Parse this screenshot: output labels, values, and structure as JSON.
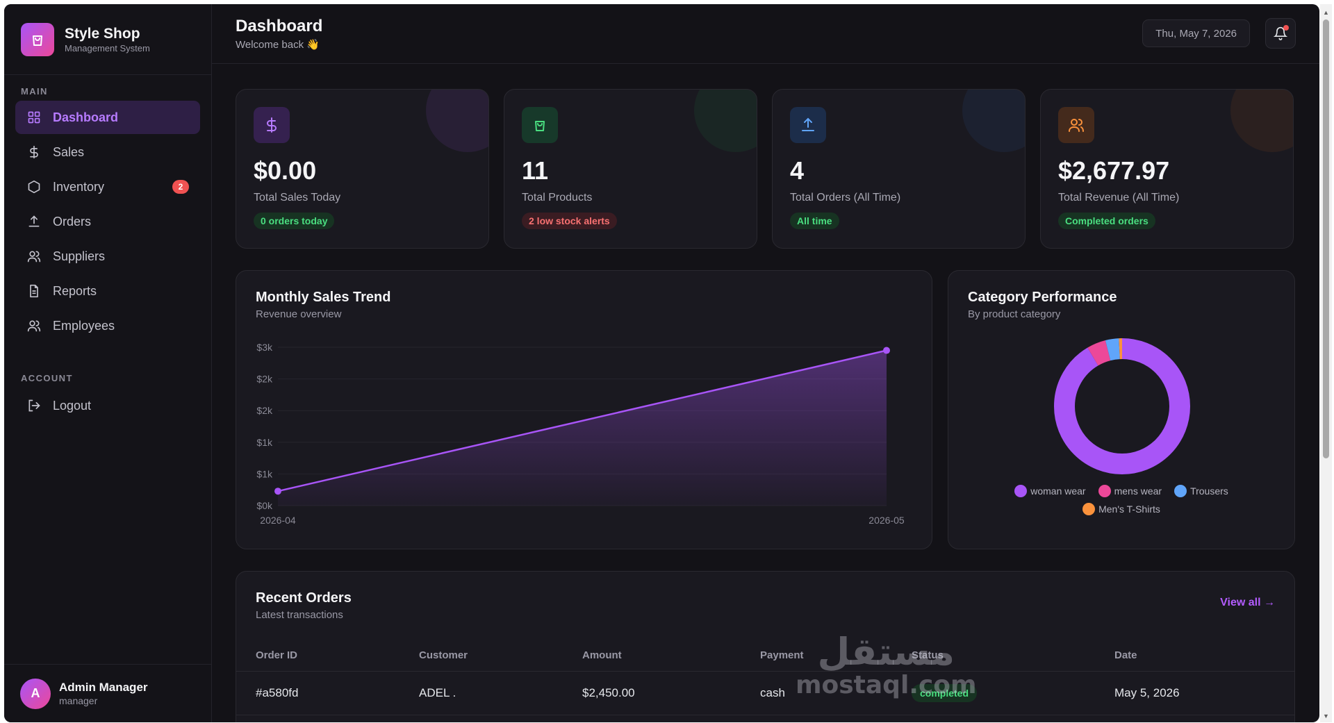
{
  "brand": {
    "name": "Style Shop",
    "subtitle": "Management System",
    "icon": "shopping-bag-icon"
  },
  "sidebar": {
    "section_main": "MAIN",
    "section_account": "ACCOUNT",
    "items": [
      {
        "label": "Dashboard",
        "icon": "dashboard-grid-icon",
        "active": true
      },
      {
        "label": "Sales",
        "icon": "dollar-icon"
      },
      {
        "label": "Inventory",
        "icon": "box-icon",
        "badge": "2"
      },
      {
        "label": "Orders",
        "icon": "upload-icon"
      },
      {
        "label": "Suppliers",
        "icon": "users-icon"
      },
      {
        "label": "Reports",
        "icon": "document-icon"
      },
      {
        "label": "Employees",
        "icon": "users-icon"
      }
    ],
    "logout": {
      "label": "Logout",
      "icon": "logout-icon"
    },
    "user": {
      "initial": "A",
      "name": "Admin Manager",
      "role": "manager"
    }
  },
  "header": {
    "title": "Dashboard",
    "subtitle": "Welcome back 👋",
    "date": "Thu, May 7, 2026"
  },
  "stats": [
    {
      "value": "$0.00",
      "label": "Total Sales Today",
      "badge": "0 orders today",
      "badge_type": "green",
      "icon": "dollar-icon",
      "accent": "#a855f7"
    },
    {
      "value": "11",
      "label": "Total Products",
      "badge": "2 low stock alerts",
      "badge_type": "red",
      "icon": "shopping-bag-icon",
      "accent": "#22c55e"
    },
    {
      "value": "4",
      "label": "Total Orders (All Time)",
      "badge": "All time",
      "badge_type": "green",
      "icon": "upload-icon",
      "accent": "#3b82f6"
    },
    {
      "value": "$2,677.97",
      "label": "Total Revenue (All Time)",
      "badge": "Completed orders",
      "badge_type": "green",
      "icon": "users-icon",
      "accent": "#f97316"
    }
  ],
  "sales_chart": {
    "title": "Monthly Sales Trend",
    "subtitle": "Revenue overview"
  },
  "category_chart": {
    "title": "Category Performance",
    "subtitle": "By product category"
  },
  "chart_data": [
    {
      "type": "area",
      "title": "Monthly Sales Trend",
      "x": [
        "2026-04",
        "2026-05"
      ],
      "series": [
        {
          "values": [
            227.97,
            2450.0
          ]
        }
      ],
      "y_tick_labels": [
        "$0k",
        "$1k",
        "$1k",
        "$2k",
        "$2k",
        "$3k"
      ],
      "ylim": [
        0,
        2500
      ],
      "grid": true,
      "color": "#a855f7"
    },
    {
      "type": "pie",
      "title": "Category Performance",
      "categories": [
        "woman wear",
        "mens wear",
        "Trousers",
        "Men's T-Shirts"
      ],
      "values": [
        91.5,
        4.5,
        3.2,
        0.8
      ],
      "colors": [
        "#a855f7",
        "#ec4899",
        "#60a5fa",
        "#fb923c"
      ],
      "legend": "bottom"
    }
  ],
  "orders": {
    "title": "Recent Orders",
    "subtitle": "Latest transactions",
    "view_all": "View all →",
    "columns": [
      "Order ID",
      "Customer",
      "Amount",
      "Payment",
      "Status",
      "Date"
    ],
    "rows": [
      {
        "id": "#a580fd",
        "customer": "ADEL .",
        "amount": "$2,450.00",
        "payment": "cash",
        "status": "completed",
        "date": "May 5, 2026"
      }
    ]
  },
  "watermark": {
    "arabic": "مستقل",
    "latin": "mostaql.com"
  }
}
